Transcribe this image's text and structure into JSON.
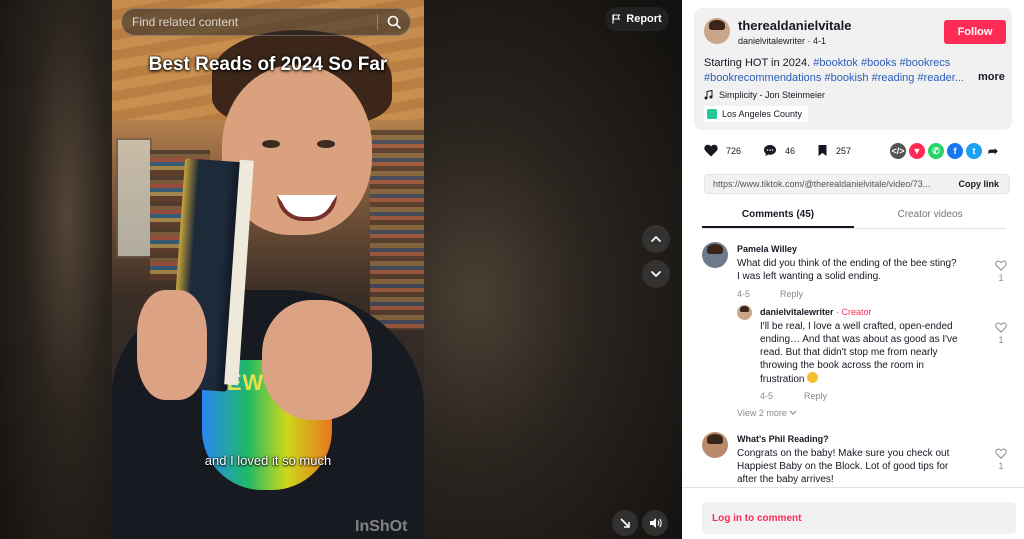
{
  "video": {
    "search_placeholder": "Find related content",
    "report_label": "Report",
    "title_overlay": "Best Reads of 2024 So Far",
    "caption": "and I loved it so much",
    "watermark": "InShOt",
    "shirt_text": "NEW YORK"
  },
  "post": {
    "username": "therealdanielvitale",
    "handle": "danielvitalewriter",
    "date": "4-1",
    "follow_label": "Follow",
    "description_text": "Starting HOT in 2024.",
    "hashtags": [
      "#booktok",
      "#books",
      "#bookrecs",
      "#bookrecommendations",
      "#bookish",
      "#reading",
      "#reader..."
    ],
    "more_label": "more",
    "music": "Simplicity - Jon Steinmeier",
    "location": "Los Angeles County"
  },
  "actions": {
    "likes": "726",
    "comments": "46",
    "saves": "257"
  },
  "share_colors": {
    "embed": "#555555",
    "pin": "#fe2c55",
    "whatsapp": "#25d366",
    "facebook": "#1877f2",
    "twitter": "#1da1f2"
  },
  "link": {
    "url": "https://www.tiktok.com/@therealdanielvitale/video/73...",
    "copy_label": "Copy link"
  },
  "tabs": {
    "comments": "Comments (45)",
    "creator_videos": "Creator videos"
  },
  "comments": [
    {
      "name": "Pamela Willey",
      "line1": "What did you think of the ending of the bee sting?",
      "line2": "I was left wanting a solid ending.",
      "date": "4-5",
      "reply": "Reply",
      "likes": "1"
    },
    {
      "name": "danielvitalewriter",
      "badge": "· Creator",
      "line1": "I'll be real, I love a well crafted, open-ended",
      "line2": "ending… And that was about as good as I've",
      "line3": "read. But that didn't stop me from nearly",
      "line4": "throwing the book across the room in",
      "line5": "frustration",
      "date": "4-5",
      "reply": "Reply",
      "likes": "1"
    },
    {
      "name": "What's Phil Reading?",
      "line1": "Congrats on the baby! Make sure you check out",
      "line2": "Happiest Baby on the Block. Lot of good tips for",
      "line3": "after the baby arrives!",
      "likes": "1"
    }
  ],
  "view_more": "View 2 more",
  "login_label": "Log in to comment"
}
